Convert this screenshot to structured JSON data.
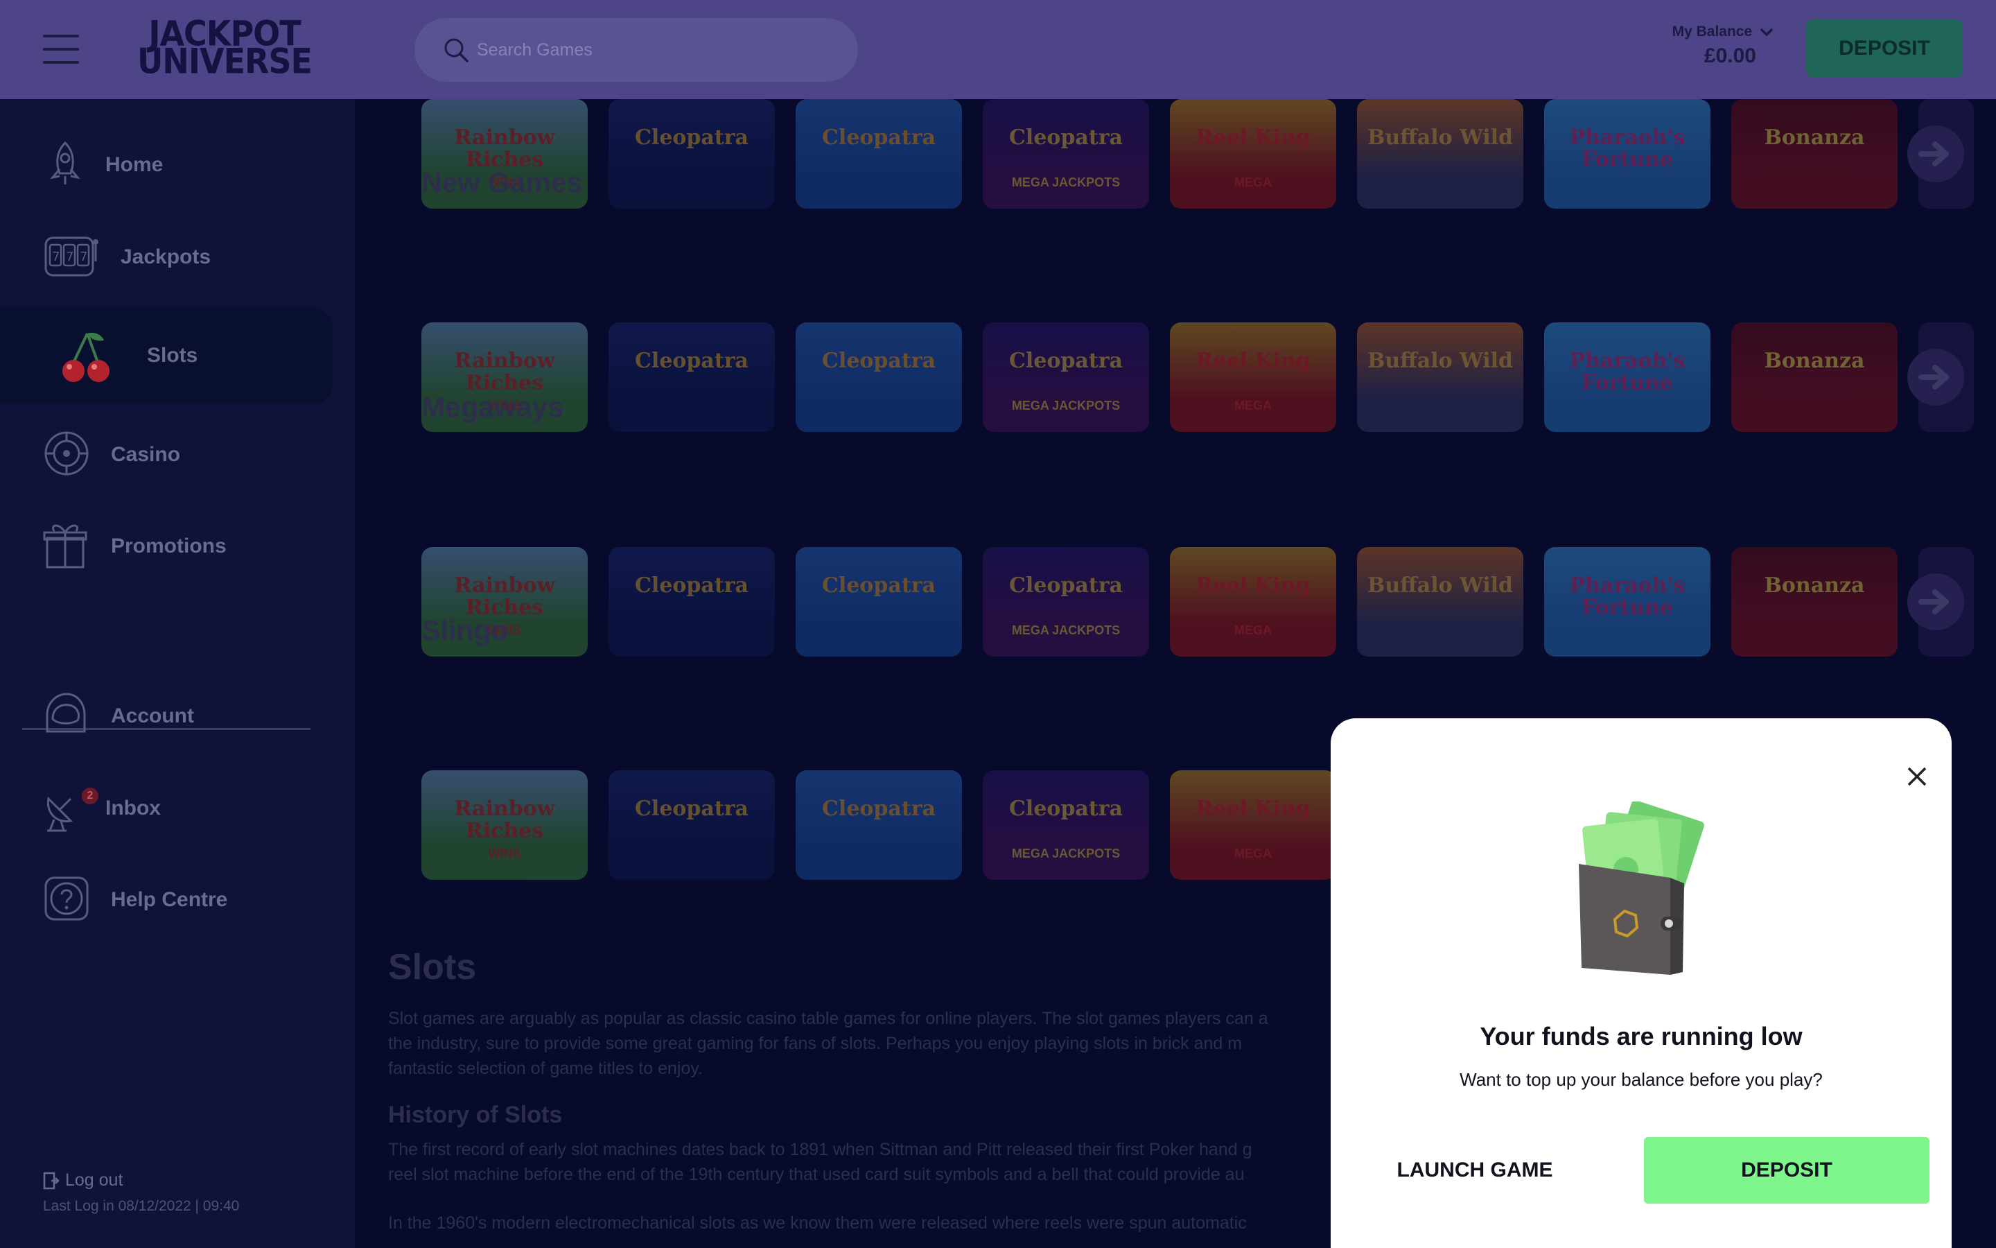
{
  "header": {
    "logo_line1": "JACKPOT",
    "logo_line2": "UNIVERSE",
    "search_placeholder": "Search Games",
    "balance_label": "My Balance",
    "balance_amount": "£0.00",
    "deposit_label": "DEPOSIT"
  },
  "sidebar": {
    "items": [
      {
        "label": "Home",
        "icon": "rocket-icon"
      },
      {
        "label": "Jackpots",
        "icon": "slot-machine-icon"
      },
      {
        "label": "Slots",
        "icon": "cherries-icon",
        "active": true
      },
      {
        "label": "Casino",
        "icon": "roulette-icon"
      },
      {
        "label": "Promotions",
        "icon": "gift-icon"
      },
      {
        "label": "Account",
        "icon": "astronaut-helmet-icon"
      },
      {
        "label": "Inbox",
        "icon": "satellite-dish-icon",
        "badge": "2"
      },
      {
        "label": "Help Centre",
        "icon": "help-icon"
      }
    ],
    "logout_label": "Log out",
    "last_login": "Last Log in 08/12/2022 | 09:40"
  },
  "rows": [
    {
      "title": ""
    },
    {
      "title": "New Games"
    },
    {
      "title": "Megaways"
    },
    {
      "title": "Slingo"
    }
  ],
  "games": [
    {
      "title": "Rainbow Riches",
      "sub": "WINS",
      "bg": "#3f8c3c",
      "sky": "#6fa3c8",
      "color": "#c43b2a"
    },
    {
      "title": "Cleopatra",
      "sub": "",
      "bg": "#0e1c5c",
      "sky": "#1b2d7a",
      "color": "#d9a93a"
    },
    {
      "title": "Cleopatra",
      "sub": "",
      "bg": "#1b56b2",
      "sky": "#2a6ac9",
      "color": "#e0a23e"
    },
    {
      "title": "Cleopatra",
      "sub": "MEGA JACKPOTS",
      "bg": "#4a1463",
      "sky": "#2a1a73",
      "color": "#e0b64a"
    },
    {
      "title": "Reel King",
      "sub": "MEGA",
      "bg": "#a61a1a",
      "sky": "#c9941f",
      "color": "#e82b2b"
    },
    {
      "title": "Buffalo Wild",
      "sub": "",
      "bg": "#3a3d6d",
      "sky": "#c46b2a",
      "color": "#e8b247"
    },
    {
      "title": "Pharaoh's Fortune",
      "sub": "",
      "bg": "#2a7bd1",
      "sky": "#3a9ae6",
      "color": "#d03a8a"
    },
    {
      "title": "Bonanza",
      "sub": "",
      "bg": "#8d1420",
      "sky": "#6b0e18",
      "color": "#f0d24a"
    }
  ],
  "article": {
    "heading": "Slots",
    "p1": "Slot games are arguably as popular as classic casino table games for online players. The slot games players can a",
    "p1b": "the industry, sure to provide some great gaming for fans of slots. Perhaps you enjoy playing slots in brick and m",
    "p1c": "fantastic selection of game titles to enjoy.",
    "subheading": "History of Slots",
    "p2": "The first record of early slot machines dates back to 1891 when Sittman and Pitt released their first Poker hand g",
    "p2b": "reel slot machine before the end of the 19th century that used card suit symbols and a bell that could provide au",
    "p3": "In the 1960's modern electromechanical slots as we know them were released where reels were spun automatic"
  },
  "modal": {
    "title": "Your funds are running low",
    "subtitle": "Want to top up your balance before you play?",
    "launch_label": "LAUNCH GAME",
    "deposit_label": "DEPOSIT"
  },
  "colors": {
    "header_bg": "#4d4587",
    "page_bg": "#0b0d33",
    "deposit_green": "#7ef58a",
    "arrow_purple": "#4b3d86"
  }
}
